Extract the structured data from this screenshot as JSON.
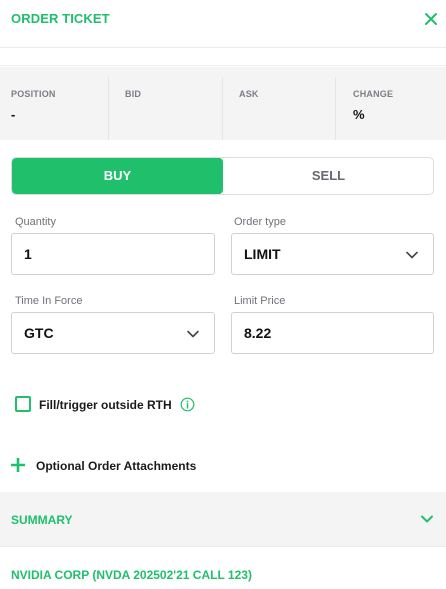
{
  "header": {
    "title": "ORDER TICKET"
  },
  "stats": [
    {
      "label": "POSITION",
      "value": "-"
    },
    {
      "label": "BID",
      "value": ""
    },
    {
      "label": "ASK",
      "value": ""
    },
    {
      "label": "CHANGE",
      "value": "%"
    }
  ],
  "side": {
    "buy_label": "BUY",
    "sell_label": "SELL",
    "selected": "BUY"
  },
  "form": {
    "quantity": {
      "label": "Quantity",
      "value": "1"
    },
    "order_type": {
      "label": "Order type",
      "value": "LIMIT"
    },
    "time_in_force": {
      "label": "Time In Force",
      "value": "GTC"
    },
    "limit_price": {
      "label": "Limit Price",
      "value": "8.22"
    }
  },
  "options": {
    "outside_rth_label": "Fill/trigger outside RTH",
    "outside_rth_checked": false
  },
  "attachments": {
    "label": "Optional Order Attachments"
  },
  "summary": {
    "title": "SUMMARY"
  },
  "instrument": {
    "label": "NVIDIA CORP (NVDA 202502'21 CALL 123)"
  },
  "colors": {
    "accent": "#1fbf6b",
    "panel_bg": "#f4f4f5",
    "muted_text": "#7b7e83"
  },
  "icons": {
    "close": "close-icon",
    "chevron": "chevron-down-icon",
    "info": "info-icon",
    "plus": "plus-icon"
  }
}
